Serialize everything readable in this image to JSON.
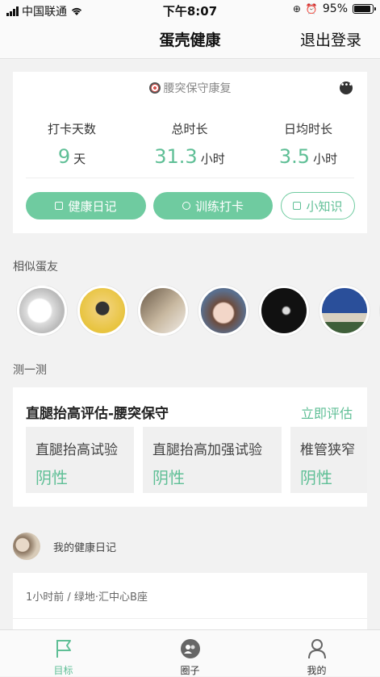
{
  "status_bar": {
    "carrier": "中国联通",
    "time": "下午8:07",
    "battery": "95%",
    "battery_level": 0.95
  },
  "nav": {
    "title": "蛋壳健康",
    "logout": "退出登录"
  },
  "plan_card": {
    "tag": "腰突保守康复",
    "stats": [
      {
        "label": "打卡天数",
        "value": "9",
        "unit": "天"
      },
      {
        "label": "总时长",
        "value": "31.3",
        "unit": "小时"
      },
      {
        "label": "日均时长",
        "value": "3.5",
        "unit": "小时"
      }
    ],
    "buttons": {
      "diary": "健康日记",
      "checkin": "训练打卡",
      "knowledge": "小知识"
    }
  },
  "similar": {
    "title": "相似蛋友"
  },
  "quiz": {
    "section_title": "测一测",
    "card_title": "直腿抬高评估-腰突保守",
    "action": "立即评估",
    "items": [
      {
        "name": "直腿抬高试验",
        "result": "阴性"
      },
      {
        "name": "直腿抬高加强试验",
        "result": "阴性"
      },
      {
        "name": "椎管狭窄",
        "result": "阴性"
      }
    ]
  },
  "diary": {
    "label": "我的健康日记",
    "meta": "1小时前 / 绿地·汇中心B座"
  },
  "tabbar": {
    "goal": "目标",
    "circle": "圈子",
    "mine": "我的"
  },
  "colors": {
    "accent": "#5fbf96",
    "button": "#6fcba0"
  }
}
